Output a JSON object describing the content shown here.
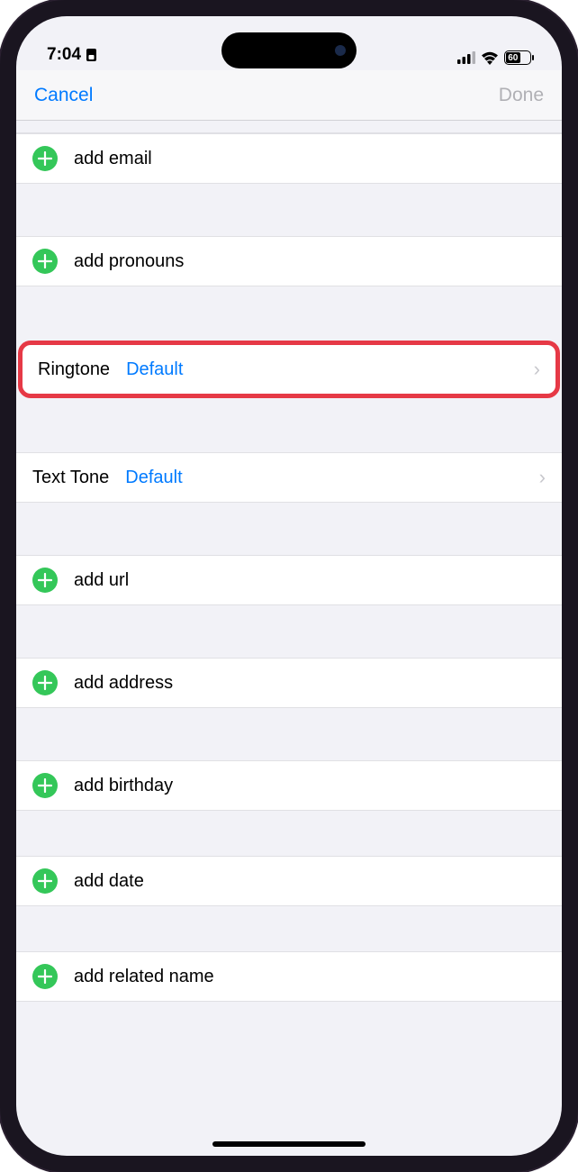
{
  "statusBar": {
    "time": "7:04",
    "batteryPercent": "60",
    "batteryWidth": "60%"
  },
  "nav": {
    "cancel": "Cancel",
    "done": "Done"
  },
  "rows": {
    "addEmail": "add email",
    "addPronouns": "add pronouns",
    "ringtoneKey": "Ringtone",
    "ringtoneValue": "Default",
    "textToneKey": "Text Tone",
    "textToneValue": "Default",
    "addUrl": "add url",
    "addAddress": "add address",
    "addBirthday": "add birthday",
    "addDate": "add date",
    "addRelatedName": "add related name"
  }
}
